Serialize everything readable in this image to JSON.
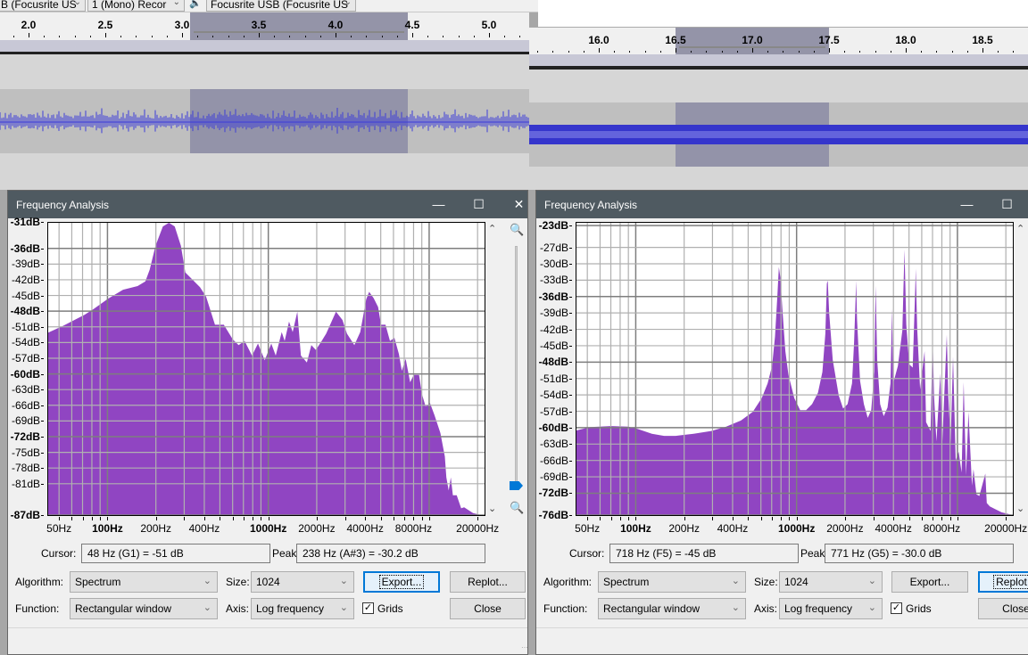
{
  "toolbar": {
    "recording_device": "B (Focusrite US",
    "recording_channels": "1 (Mono) Recor",
    "speaker_icon": "speaker-icon",
    "playback_device": "Focusrite USB (Focusrite US"
  },
  "left_track": {
    "ruler_labels": [
      "2.0",
      "2.5",
      "3.0",
      "3.5",
      "4.0",
      "4.5",
      "5.0"
    ],
    "ruler_values": [
      2.0,
      2.5,
      3.0,
      3.5,
      4.0,
      4.5,
      5.0
    ],
    "selection_seconds": [
      3.05,
      4.47
    ],
    "waveform_color": "#3c3cd8"
  },
  "right_track": {
    "ruler_labels": [
      "16.0",
      "16.5",
      "17.0",
      "17.5",
      "18.0",
      "18.5"
    ],
    "ruler_values": [
      16.0,
      16.5,
      17.0,
      17.5,
      18.0,
      18.5
    ],
    "selection_seconds": [
      16.5,
      17.5
    ],
    "waveform_color": "#3535cc"
  },
  "dialogs": [
    {
      "title": "Frequency Analysis",
      "cursor_label": "Cursor:",
      "cursor_value": "48 Hz (G1) = -51 dB",
      "peak_label": "Peak:",
      "peak_value": "238 Hz (A#3) = -30.2 dB",
      "algorithm_label": "Algorithm:",
      "algorithm_value": "Spectrum",
      "size_label": "Size:",
      "size_value": "1024",
      "function_label": "Function:",
      "function_value": "Rectangular window",
      "axis_label": "Axis:",
      "axis_value": "Log frequency",
      "grids_label": "Grids",
      "grids_checked": true,
      "export_label": "Export...",
      "replot_label": "Replot...",
      "close_label": "Close",
      "focused_button": "export"
    },
    {
      "title": "Frequency Analysis",
      "cursor_label": "Cursor:",
      "cursor_value": "718 Hz (F5) = -45 dB",
      "peak_label": "Peak:",
      "peak_value": "771 Hz (G5) = -30.0 dB",
      "algorithm_label": "Algorithm:",
      "algorithm_value": "Spectrum",
      "size_label": "Size:",
      "size_value": "1024",
      "function_label": "Function:",
      "function_value": "Rectangular window",
      "axis_label": "Axis:",
      "axis_value": "Log frequency",
      "grids_label": "Grids",
      "grids_checked": true,
      "export_label": "Export...",
      "replot_label": "Replot...",
      "close_label": "Close",
      "focused_button": "replot"
    }
  ],
  "chart_data": [
    {
      "type": "area",
      "xscale": "log",
      "xlim": [
        42.8,
        22100
      ],
      "ylim": [
        -87,
        -31.1
      ],
      "grid": true,
      "fill_color": "#8a3bbf",
      "x_tick_labels": [
        "50Hz",
        "100Hz",
        "200Hz",
        "400Hz",
        "1000Hz",
        "2000Hz",
        "4000Hz",
        "8000Hz",
        "20000Hz"
      ],
      "x_tick_values": [
        50,
        100,
        200,
        400,
        1000,
        2000,
        4000,
        8000,
        20000
      ],
      "y_tick_labels": [
        "-31dB",
        "-36dB",
        "-39dB",
        "-42dB",
        "-45dB",
        "-48dB",
        "-51dB",
        "-54dB",
        "-57dB",
        "-60dB",
        "-63dB",
        "-66dB",
        "-69dB",
        "-72dB",
        "-75dB",
        "-78dB",
        "-81dB",
        "-87dB"
      ],
      "y_tick_values": [
        -31,
        -36,
        -39,
        -42,
        -45,
        -48,
        -51,
        -54,
        -57,
        -60,
        -63,
        -66,
        -69,
        -72,
        -75,
        -78,
        -81,
        -87
      ],
      "y_bold": [
        -31,
        -36,
        -48,
        -60,
        -72,
        -87
      ],
      "points": [
        [
          42.8,
          -52.1
        ],
        [
          53,
          -50.8
        ],
        [
          72,
          -48.7
        ],
        [
          82,
          -47.6
        ],
        [
          101,
          -45.6
        ],
        [
          125,
          -43.9
        ],
        [
          154,
          -43.2
        ],
        [
          172,
          -42.3
        ],
        [
          183,
          -40.1
        ],
        [
          199,
          -35.5
        ],
        [
          221,
          -31.8
        ],
        [
          241,
          -31.1
        ],
        [
          262,
          -31.8
        ],
        [
          286,
          -35.5
        ],
        [
          305,
          -40.6
        ],
        [
          376,
          -43.4
        ],
        [
          410,
          -45.2
        ],
        [
          466,
          -50.6
        ],
        [
          529,
          -50.6
        ],
        [
          601,
          -53.4
        ],
        [
          654,
          -54.5
        ],
        [
          712,
          -53.7
        ],
        [
          792,
          -56.5
        ],
        [
          862,
          -54.2
        ],
        [
          950,
          -57.4
        ],
        [
          1043,
          -54.2
        ],
        [
          1112,
          -56.5
        ],
        [
          1211,
          -52.0
        ],
        [
          1263,
          -53.7
        ],
        [
          1346,
          -50.0
        ],
        [
          1417,
          -52.0
        ],
        [
          1516,
          -48.1
        ],
        [
          1595,
          -56.5
        ],
        [
          1737,
          -57.8
        ],
        [
          1851,
          -54.5
        ],
        [
          1973,
          -55.4
        ],
        [
          2148,
          -53.7
        ],
        [
          2289,
          -52.3
        ],
        [
          2634,
          -48.1
        ],
        [
          2892,
          -49.7
        ],
        [
          3083,
          -52.3
        ],
        [
          3428,
          -54.5
        ],
        [
          3731,
          -52.0
        ],
        [
          4062,
          -45.7
        ],
        [
          4239,
          -44.3
        ],
        [
          4517,
          -45.5
        ],
        [
          4815,
          -47.2
        ],
        [
          5023,
          -50.6
        ],
        [
          5354,
          -50.6
        ],
        [
          5706,
          -53.7
        ],
        [
          6081,
          -53.1
        ],
        [
          6481,
          -56.2
        ],
        [
          6763,
          -59.4
        ],
        [
          7147,
          -57.1
        ],
        [
          7616,
          -61.6
        ],
        [
          8014,
          -60.2
        ],
        [
          8652,
          -60.2
        ],
        [
          9027,
          -63.9
        ],
        [
          9500,
          -66.2
        ],
        [
          10125,
          -65.6
        ],
        [
          10790,
          -67.9
        ],
        [
          11745,
          -71.3
        ],
        [
          12520,
          -75.8
        ],
        [
          12790,
          -79.8
        ],
        [
          13230,
          -82.3
        ],
        [
          13630,
          -79.8
        ],
        [
          14040,
          -83.2
        ],
        [
          14840,
          -83.2
        ],
        [
          15810,
          -85.7
        ],
        [
          16500,
          -85.5
        ],
        [
          18740,
          -86.6
        ],
        [
          20400,
          -86.9
        ],
        [
          22100,
          -87.0
        ]
      ]
    },
    {
      "type": "area",
      "xscale": "log",
      "xlim": [
        42.8,
        22100
      ],
      "ylim": [
        -76,
        -22.5
      ],
      "grid": true,
      "fill_color": "#8a3bbf",
      "x_tick_labels": [
        "50Hz",
        "100Hz",
        "200Hz",
        "400Hz",
        "1000Hz",
        "2000Hz",
        "4000Hz",
        "8000Hz",
        "20000Hz"
      ],
      "x_tick_values": [
        50,
        100,
        200,
        400,
        1000,
        2000,
        4000,
        8000,
        20000
      ],
      "y_tick_labels": [
        "-23dB",
        "-27dB",
        "-30dB",
        "-33dB",
        "-36dB",
        "-39dB",
        "-42dB",
        "-45dB",
        "-48dB",
        "-51dB",
        "-54dB",
        "-57dB",
        "-60dB",
        "-63dB",
        "-66dB",
        "-69dB",
        "-72dB",
        "-76dB"
      ],
      "y_tick_values": [
        -23,
        -27,
        -30,
        -33,
        -36,
        -39,
        -42,
        -45,
        -48,
        -51,
        -54,
        -57,
        -60,
        -63,
        -66,
        -69,
        -72,
        -76
      ],
      "y_bold": [
        -23,
        -36,
        -48,
        -60,
        -72,
        -76
      ],
      "points": [
        [
          42.8,
          -60.5
        ],
        [
          52,
          -59.9
        ],
        [
          70,
          -59.7
        ],
        [
          90,
          -59.8
        ],
        [
          102,
          -60.2
        ],
        [
          126,
          -61.1
        ],
        [
          150,
          -61.5
        ],
        [
          177,
          -61.5
        ],
        [
          229,
          -61.1
        ],
        [
          295,
          -60.6
        ],
        [
          365,
          -59.8
        ],
        [
          451,
          -58.7
        ],
        [
          534,
          -57.1
        ],
        [
          607,
          -54.6
        ],
        [
          660,
          -51.9
        ],
        [
          704,
          -48.7
        ],
        [
          734,
          -43.3
        ],
        [
          760,
          -35.7
        ],
        [
          776,
          -30.6
        ],
        [
          793,
          -32.5
        ],
        [
          816,
          -38.4
        ],
        [
          852,
          -46.0
        ],
        [
          889,
          -50.3
        ],
        [
          967,
          -54.6
        ],
        [
          1053,
          -56.8
        ],
        [
          1146,
          -56.8
        ],
        [
          1247,
          -55.7
        ],
        [
          1358,
          -53.6
        ],
        [
          1447,
          -49.8
        ],
        [
          1510,
          -42.8
        ],
        [
          1542,
          -33.6
        ],
        [
          1562,
          -33.1
        ],
        [
          1595,
          -39.0
        ],
        [
          1678,
          -47.6
        ],
        [
          1827,
          -54.1
        ],
        [
          1947,
          -56.5
        ],
        [
          2075,
          -55.7
        ],
        [
          2211,
          -51.9
        ],
        [
          2278,
          -44.4
        ],
        [
          2317,
          -37.9
        ],
        [
          2346,
          -33.1
        ],
        [
          2376,
          -40.1
        ],
        [
          2480,
          -51.4
        ],
        [
          2620,
          -55.7
        ],
        [
          2769,
          -58.2
        ],
        [
          2912,
          -56.8
        ],
        [
          3039,
          -49.8
        ],
        [
          3104,
          -34.0
        ],
        [
          3170,
          -47.6
        ],
        [
          3307,
          -55.7
        ],
        [
          3480,
          -57.9
        ],
        [
          3678,
          -56.3
        ],
        [
          3837,
          -51.9
        ],
        [
          3919,
          -38.2
        ],
        [
          3986,
          -51.9
        ],
        [
          4266,
          -48.7
        ],
        [
          4546,
          -42.2
        ],
        [
          4684,
          -27.4
        ],
        [
          4805,
          -41.1
        ],
        [
          5012,
          -48.4
        ],
        [
          5274,
          -49.0
        ],
        [
          5457,
          -35.2
        ],
        [
          5503,
          -30.9
        ],
        [
          5620,
          -41.7
        ],
        [
          5864,
          -53.0
        ],
        [
          6248,
          -46.0
        ],
        [
          6383,
          -59.0
        ],
        [
          6802,
          -60.6
        ],
        [
          7007,
          -43.3
        ],
        [
          7157,
          -54.1
        ],
        [
          7403,
          -62.5
        ],
        [
          7822,
          -50.1
        ],
        [
          8059,
          -62.5
        ],
        [
          8587,
          -43.0
        ],
        [
          8771,
          -54.1
        ],
        [
          9075,
          -62.8
        ],
        [
          9389,
          -47.0
        ],
        [
          9752,
          -66.0
        ],
        [
          10176,
          -64.4
        ],
        [
          10617,
          -68.2
        ],
        [
          10937,
          -51.7
        ],
        [
          11313,
          -68.7
        ],
        [
          11706,
          -57.1
        ],
        [
          12312,
          -70.6
        ],
        [
          12576,
          -67.6
        ],
        [
          13124,
          -72.2
        ],
        [
          13693,
          -72.5
        ],
        [
          14909,
          -68.4
        ],
        [
          15228,
          -73.8
        ],
        [
          15885,
          -74.4
        ],
        [
          17147,
          -74.9
        ],
        [
          18821,
          -75.5
        ],
        [
          22100,
          -76.0
        ]
      ]
    }
  ]
}
